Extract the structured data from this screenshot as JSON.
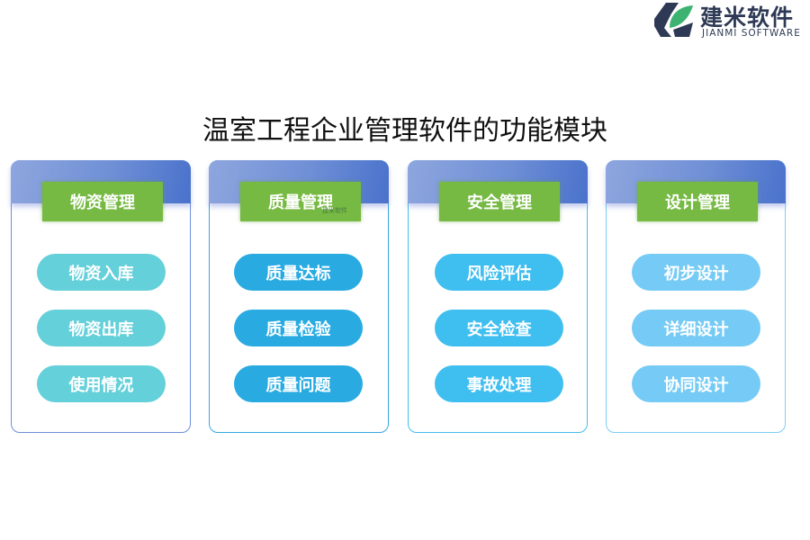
{
  "logo": {
    "name_cn": "建米软件",
    "name_en": "JIANMI SOFTWARE",
    "icon": "jianmi-logo-icon"
  },
  "title": "温室工程企业管理软件的功能模块",
  "colors": {
    "header_gradient_start": "#8ea6de",
    "header_gradient_end": "#4a72cc",
    "label_green": "#76b943"
  },
  "modules": [
    {
      "label": "物资管理",
      "pill_color": "#64d0da",
      "items": [
        "物资入库",
        "物资出库",
        "使用情况"
      ]
    },
    {
      "label": "质量管理",
      "pill_color": "#29abe2",
      "items": [
        "质量达标",
        "质量检验",
        "质量问题"
      ]
    },
    {
      "label": "安全管理",
      "pill_color": "#3fbef0",
      "items": [
        "风险评估",
        "安全检查",
        "事故处理"
      ]
    },
    {
      "label": "设计管理",
      "pill_color": "#75cbf5",
      "items": [
        "初步设计",
        "详细设计",
        "协同设计"
      ]
    }
  ],
  "watermark": "建米软件"
}
